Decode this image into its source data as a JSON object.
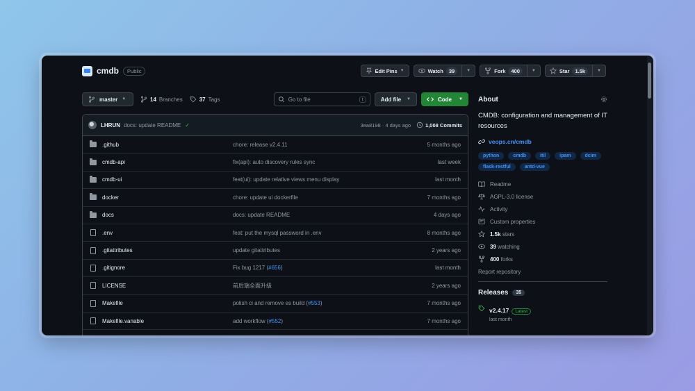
{
  "repo": {
    "name": "cmdb",
    "visibility": "Public"
  },
  "header": {
    "edit_pins": "Edit Pins",
    "watch": {
      "label": "Watch",
      "count": "39"
    },
    "fork": {
      "label": "Fork",
      "count": "400"
    },
    "star": {
      "label": "Star",
      "count": "1.5k"
    }
  },
  "toolbar": {
    "branch": "master",
    "branches": {
      "count": "14",
      "label": "Branches"
    },
    "tags": {
      "count": "37",
      "label": "Tags"
    },
    "search_placeholder": "Go to file",
    "search_shortcut": "t",
    "add_file": "Add file",
    "code": "Code"
  },
  "latest_commit": {
    "author": "LHRUN",
    "message": "docs: update README",
    "hash": "3ea8198",
    "time": "4 days ago",
    "commits": "1,008 Commits"
  },
  "files": [
    {
      "name": ".github",
      "type": "folder",
      "message": "chore: release v2.4.11",
      "pr": "",
      "suffix": "",
      "time": "5 months ago"
    },
    {
      "name": "cmdb-api",
      "type": "folder",
      "message": "fix(api): auto discovery rules sync",
      "pr": "",
      "suffix": "",
      "time": "last week"
    },
    {
      "name": "cmdb-ui",
      "type": "folder",
      "message": "feat(ui): update relative views menu display",
      "pr": "",
      "suffix": "",
      "time": "last month"
    },
    {
      "name": "docker",
      "type": "folder",
      "message": "chore: update ui dockerfile",
      "pr": "",
      "suffix": "",
      "time": "7 months ago"
    },
    {
      "name": "docs",
      "type": "folder",
      "message": "docs: update README",
      "pr": "",
      "suffix": "",
      "time": "4 days ago"
    },
    {
      "name": ".env",
      "type": "file",
      "message": "feat: put the mysql password in .env",
      "pr": "",
      "suffix": "",
      "time": "8 months ago"
    },
    {
      "name": ".gitattributes",
      "type": "file",
      "message": "update gitattributes",
      "pr": "",
      "suffix": "",
      "time": "2 years ago"
    },
    {
      "name": ".gitignore",
      "type": "file",
      "message": "Fix bug 1217 (",
      "pr": "#656",
      "suffix": ")",
      "time": "last month"
    },
    {
      "name": "LICENSE",
      "type": "file",
      "message": "前后端全面升级",
      "pr": "",
      "suffix": "",
      "time": "2 years ago"
    },
    {
      "name": "Makefile",
      "type": "file",
      "message": "polish ci and remove es build (",
      "pr": "#553",
      "suffix": ")",
      "time": "7 months ago"
    },
    {
      "name": "Makefile.variable",
      "type": "file",
      "message": "add workflow (",
      "pr": "#552",
      "suffix": ")",
      "time": "7 months ago"
    }
  ],
  "about": {
    "title": "About",
    "description": "CMDB: configuration and management of IT resources",
    "link": "veops.cn/cmdb",
    "topics": [
      "python",
      "cmdb",
      "itil",
      "ipam",
      "dcim",
      "flask-restful",
      "antd-vue"
    ],
    "readme": "Readme",
    "license": "AGPL-3.0 license",
    "activity": "Activity",
    "custom_properties": "Custom properties",
    "stars": {
      "count": "1.5k",
      "label": "stars"
    },
    "watching": {
      "count": "39",
      "label": "watching"
    },
    "forks": {
      "count": "400",
      "label": "forks"
    },
    "report": "Report repository"
  },
  "releases": {
    "title": "Releases",
    "count": "35",
    "latest_tag": "v2.4.17",
    "latest_label": "Latest",
    "latest_date": "last month"
  },
  "colors": {
    "accent_blue": "#4493f8",
    "code_green": "#238636",
    "bg": "#0d1117"
  },
  "icons": [
    "repo-icon",
    "pin-icon",
    "eye-icon",
    "fork-icon",
    "star-icon",
    "branch-icon",
    "tag-icon",
    "search-icon",
    "code-icon",
    "history-icon",
    "folder-icon",
    "file-icon",
    "gear-icon",
    "link-icon",
    "book-icon",
    "scale-icon",
    "pulse-icon",
    "note-icon"
  ]
}
